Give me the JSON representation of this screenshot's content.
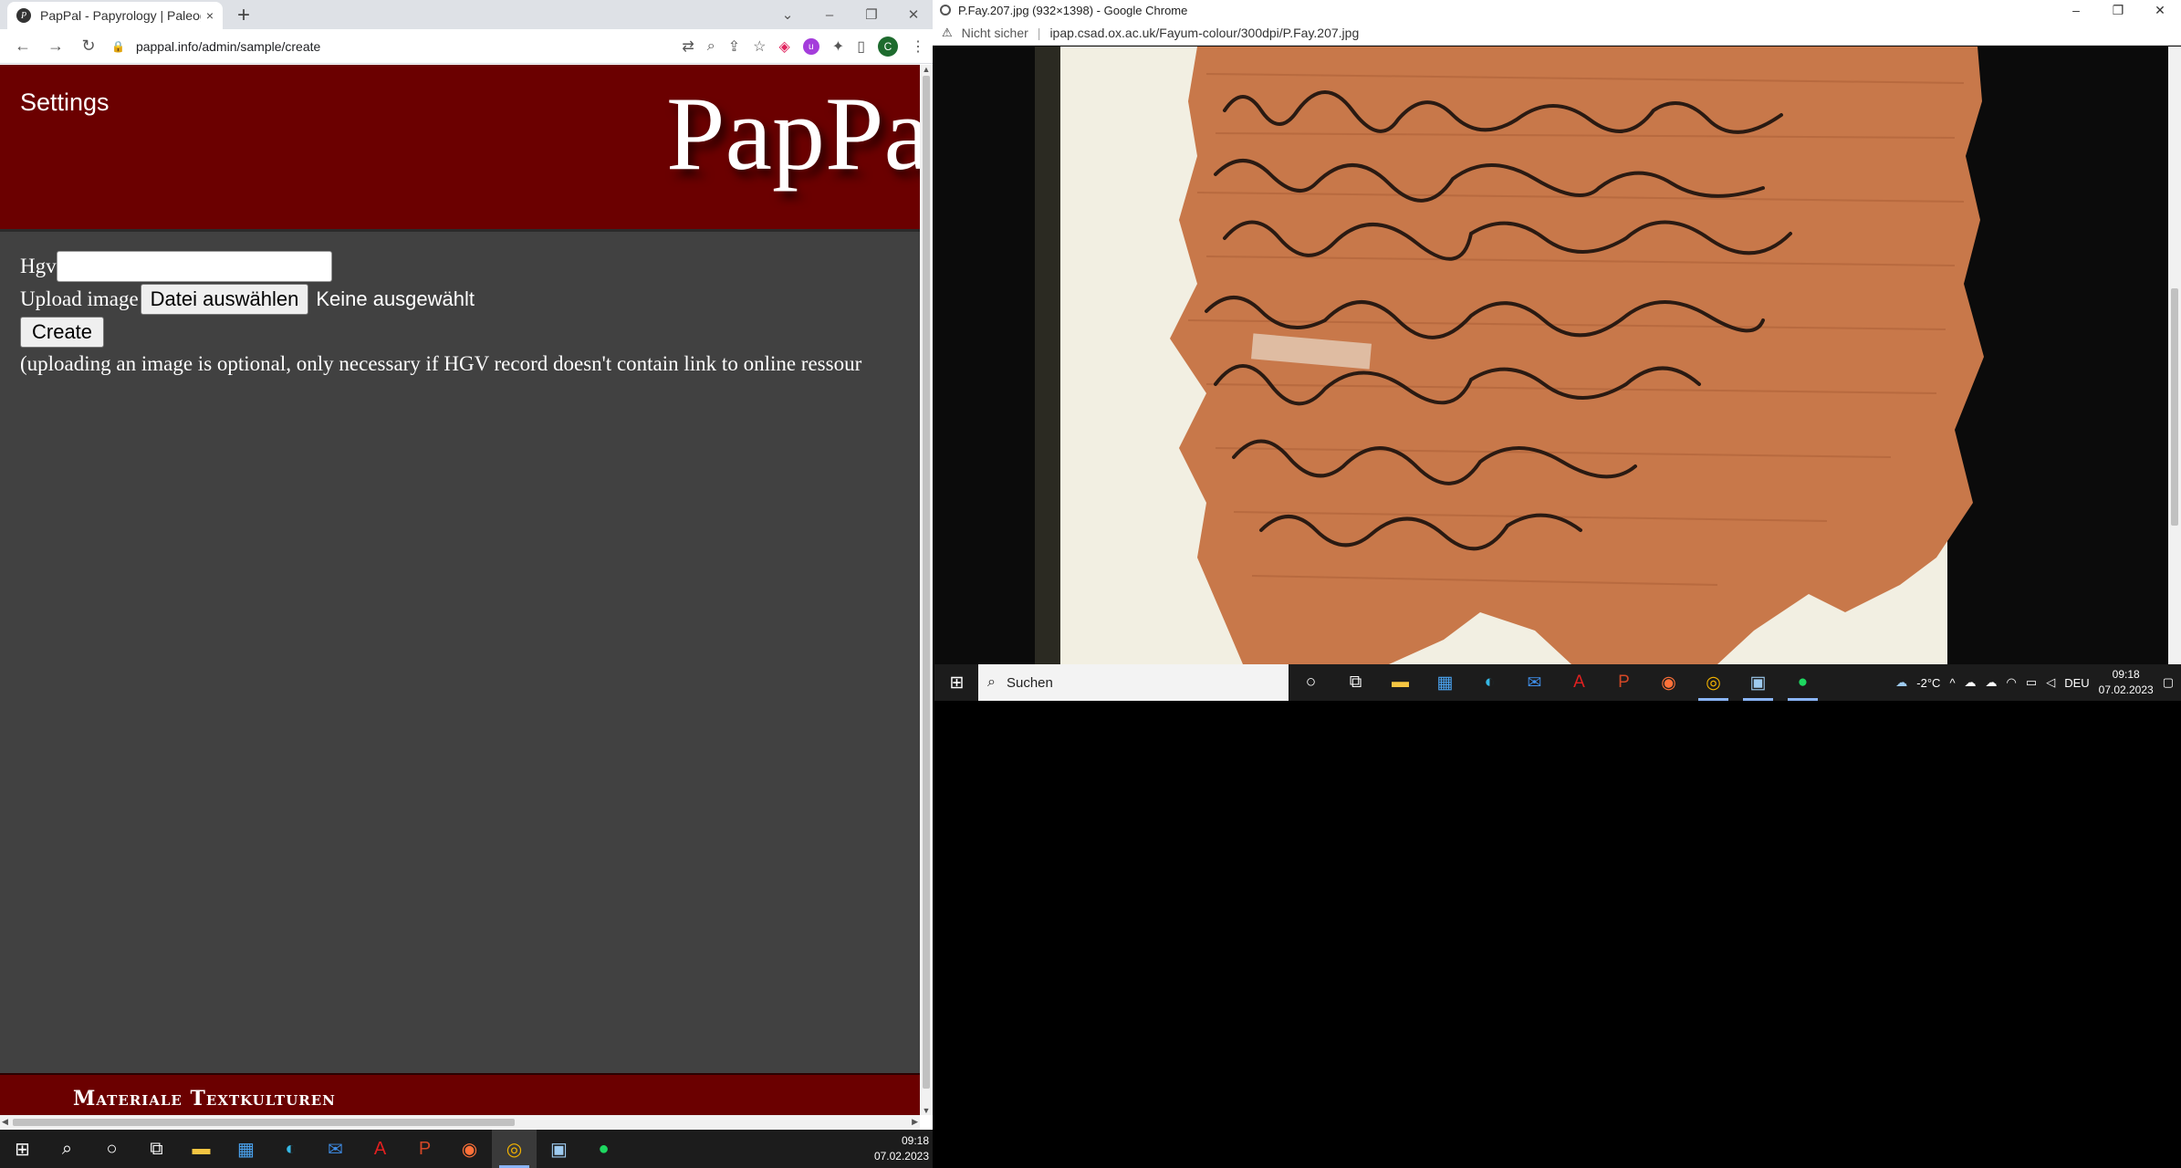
{
  "left_window": {
    "tab": {
      "favicon": "pappal-favicon",
      "title": "PapPal - Papyrology | Paleograph",
      "close": "×"
    },
    "new_tab": "+",
    "window_controls": {
      "minimize": "–",
      "restore": "❐",
      "close": "✕",
      "dropdown": "⌄"
    },
    "toolbar": {
      "back": "←",
      "forward": "→",
      "reload": "↻",
      "url": "pappal.info/admin/sample/create"
    },
    "page": {
      "settings_link": "Settings",
      "logo_text": "PapPal",
      "form": {
        "hgv_label": "Hgv",
        "hgv_value": "",
        "upload_label": "Upload image",
        "file_button": "Datei auswählen",
        "file_status": "Keine ausgewählt",
        "create_button": "Create",
        "note": "(uploading an image is optional, only necessary if HGV record doesn't contain link to online ressour"
      },
      "footer_text": "Materiale Textkulturen"
    }
  },
  "left_taskbar": {
    "items": [
      "windows-start-icon",
      "search-icon",
      "cortana-icon",
      "task-view-icon",
      "file-explorer-icon",
      "store-icon",
      "edge-icon",
      "mail-icon",
      "acrobat-icon",
      "powerpoint-icon",
      "firefox-icon",
      "chrome-icon",
      "app-icon",
      "spotify-icon"
    ],
    "time": "09:18",
    "date": "07.02.2023"
  },
  "right_window": {
    "title": "P.Fay.207.jpg (932×1398) - Google Chrome",
    "security": "Nicht sicher",
    "url": "ipap.csad.ox.ac.uk/Fayum-colour/300dpi/P.Fay.207.jpg",
    "window_controls": {
      "minimize": "–",
      "restore": "❐",
      "close": "✕"
    },
    "zoom_icon": "⌕"
  },
  "right_taskbar": {
    "search_placeholder": "Suchen",
    "weather": "-2°C",
    "language": "DEU",
    "time": "09:18",
    "date": "07.02.2023"
  },
  "colors": {
    "header_red": "#6b0000",
    "page_bg": "#414141",
    "papyrus": "#c8784a"
  }
}
